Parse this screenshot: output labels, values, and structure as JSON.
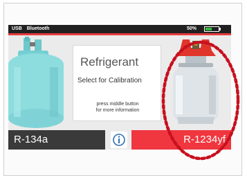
{
  "status": {
    "usb": "USB",
    "bluetooth": "Bluetooth",
    "battery_text": "50%",
    "battery_level": 0.5
  },
  "card": {
    "title": "Refrigerant",
    "subtitle": "Select for Calibration",
    "hint_line1": "press middle button",
    "hint_line2": "for more information"
  },
  "left_option": {
    "label": "R-134a",
    "color": "#3a3a3a"
  },
  "right_option": {
    "label": "R-1234yf",
    "color": "#f0363f"
  },
  "info_button": {
    "icon": "info-icon"
  },
  "colors": {
    "accent_red": "#e53a3f",
    "teal_cylinder": "#7fd3d6",
    "highlight_dots": "#c8101f"
  }
}
